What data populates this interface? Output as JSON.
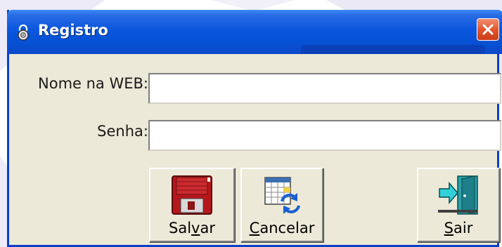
{
  "window": {
    "title": "Registro",
    "icon": "lock-icon",
    "close_icon": "close-icon"
  },
  "form": {
    "web_name_label": "Nome na WEB:",
    "web_name_value": "",
    "password_label": "Senha:",
    "password_value": ""
  },
  "buttons": {
    "save": {
      "label_pre": "Sal",
      "label_accel": "v",
      "label_post": "ar",
      "icon": "floppy-disk-icon"
    },
    "cancel": {
      "label_pre": "",
      "label_accel": "C",
      "label_post": "ancelar",
      "icon": "calendar-refresh-icon"
    },
    "exit": {
      "label_pre": "",
      "label_accel": "S",
      "label_post": "air",
      "icon": "exit-door-icon"
    }
  },
  "colors": {
    "titlebar": "#0652d6",
    "dialog_bg": "#ece9d8",
    "close_button": "#e0522b"
  }
}
